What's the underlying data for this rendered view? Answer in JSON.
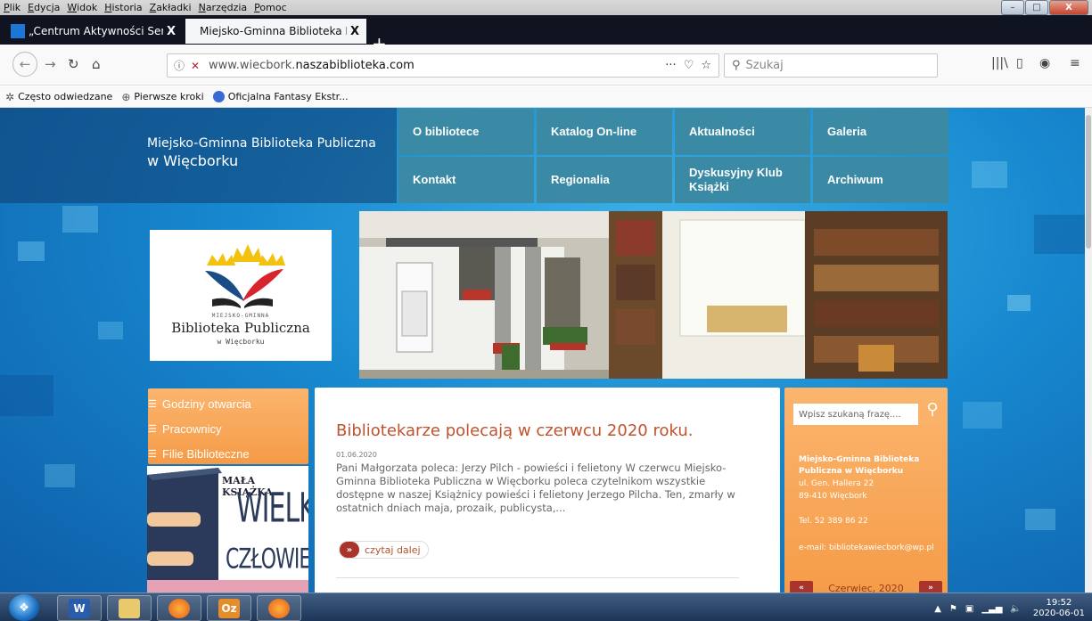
{
  "menubar": {
    "items": [
      "Plik",
      "Edycja",
      "Widok",
      "Historia",
      "Zakładki",
      "Narzędzia",
      "Pomoc"
    ],
    "window_controls": {
      "minimize": "–",
      "maximize": "□",
      "close": "X"
    }
  },
  "tabs": [
    {
      "label": "„Centrum Aktywności Seniora",
      "close": "X",
      "active": false
    },
    {
      "label": "Miejsko-Gminna Biblioteka Publiczn",
      "close": "X",
      "active": true
    }
  ],
  "newtab_label": "+",
  "navbar": {
    "url_prefix": "www.wiecbork.",
    "url_domain": "naszabiblioteka.com",
    "url_actions": "···",
    "search_placeholder": "Szukaj"
  },
  "bookmarks": [
    {
      "label": "Często odwiedzane",
      "icon": "gear-icon"
    },
    {
      "label": "Pierwsze kroki",
      "icon": "globe-icon"
    },
    {
      "label": "Oficjalna Fantasy Ekstr...",
      "icon": "firefox-icon"
    }
  ],
  "site": {
    "title_line1": "Miejsko-Gminna Biblioteka Publiczna",
    "title_line2": "w Więcborku",
    "menu": [
      {
        "label": "O bibliotece"
      },
      {
        "label": "Katalog On-line"
      },
      {
        "label": "Aktualności"
      },
      {
        "label": "Galeria"
      },
      {
        "label": "Kontakt"
      },
      {
        "label": "Regionalia"
      },
      {
        "label": "Dyskusyjny Klub Książki"
      },
      {
        "label": "Archiwum"
      }
    ],
    "logo": {
      "small": "MIEJSKO-GMINNA",
      "main": "Biblioteka Publiczna",
      "sub": "w Więcborku"
    },
    "side_menu": [
      {
        "label": "Godziny otwarcia"
      },
      {
        "label": "Pracownicy"
      },
      {
        "label": "Filie Biblioteczne"
      }
    ],
    "promo": {
      "line1": "MAŁA KSIĄŻKA",
      "line2": "WIELKI",
      "line3": "CZŁOWIEK"
    },
    "article": {
      "title": "Bibliotekarze polecają w czerwcu 2020 roku.",
      "date": "01.06.2020",
      "excerpt": "Pani Małgorzata poleca: Jerzy Pilch - powieści i felietony W czerwcu Miejsko-Gminna Biblioteka Publiczna w Więcborku poleca czytelnikom wszystkie dostępne w naszej Książnicy powieści i felietony Jerzego Pilcha. Ten, zmarły w ostatnich dniach maja, prozaik, publicysta,...",
      "read_more_icon": "»",
      "read_more": "czytaj dalej"
    },
    "right_panel": {
      "search_placeholder": "Wpisz szukaną frazę....",
      "org_name": "Miejsko-Gminna Biblioteka Publiczna w Więcborku",
      "street": "ul. Gen. Hallera 22",
      "city": "89-410 Więcbork",
      "phone": "Tel. 52 389 86 22",
      "email": "e-mail: bibliotekawiecbork@wp.pl",
      "calendar_month": "Czerwiec, 2020",
      "prev": "«",
      "next": "»"
    }
  },
  "taskbar": {
    "apps": [
      "word-icon",
      "explorer-icon",
      "firefox-icon",
      "outlook-icon",
      "firefox-icon"
    ],
    "word_label": "W",
    "outlook_label": "Oz",
    "time": "19:52",
    "date": "2020-06-01"
  }
}
